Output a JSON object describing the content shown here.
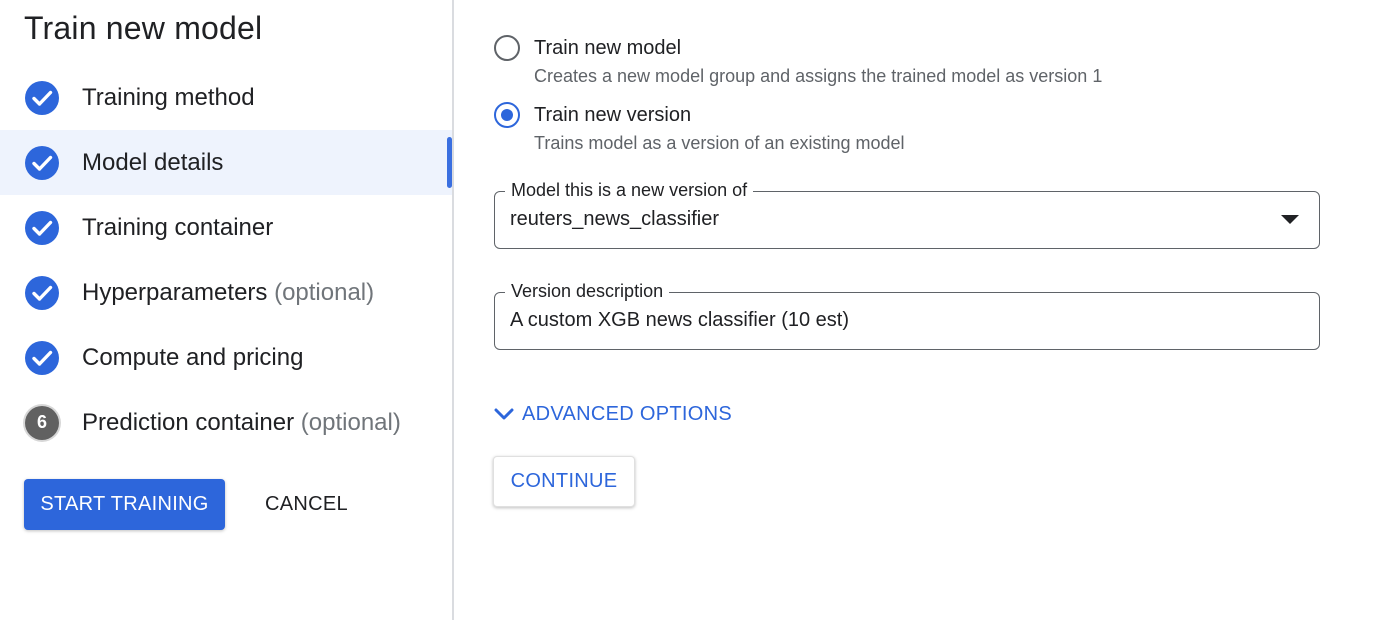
{
  "title": "Train new model",
  "steps": [
    {
      "label": "Training method",
      "optional": "",
      "status": "complete",
      "icon": "check-circle-icon"
    },
    {
      "label": "Model details",
      "optional": "",
      "status": "complete",
      "icon": "check-circle-icon",
      "active": true
    },
    {
      "label": "Training container",
      "optional": "",
      "status": "complete",
      "icon": "check-circle-icon"
    },
    {
      "label": "Hyperparameters",
      "optional": "(optional)",
      "status": "complete",
      "icon": "check-circle-icon"
    },
    {
      "label": "Compute and pricing",
      "optional": "",
      "status": "complete",
      "icon": "check-circle-icon"
    },
    {
      "label": "Prediction container",
      "optional": "(optional)",
      "status": "pending",
      "number": "6"
    }
  ],
  "actions": {
    "start_label": "START TRAINING",
    "cancel_label": "CANCEL"
  },
  "options": [
    {
      "label": "Train new model",
      "description": "Creates a new model group and assigns the trained model as version 1",
      "checked": false
    },
    {
      "label": "Train new version",
      "description": "Trains model as a version of an existing model",
      "checked": true
    }
  ],
  "model_select": {
    "label": "Model this is a new version of",
    "value": "reuters_news_classifier"
  },
  "version_description": {
    "label": "Version description",
    "value": "A custom XGB news classifier (10 est)"
  },
  "advanced_label": "ADVANCED OPTIONS",
  "continue_label": "CONTINUE",
  "colors": {
    "accent": "#2d66db",
    "active_bg": "#eef3fd",
    "pending_step": "#616161"
  }
}
